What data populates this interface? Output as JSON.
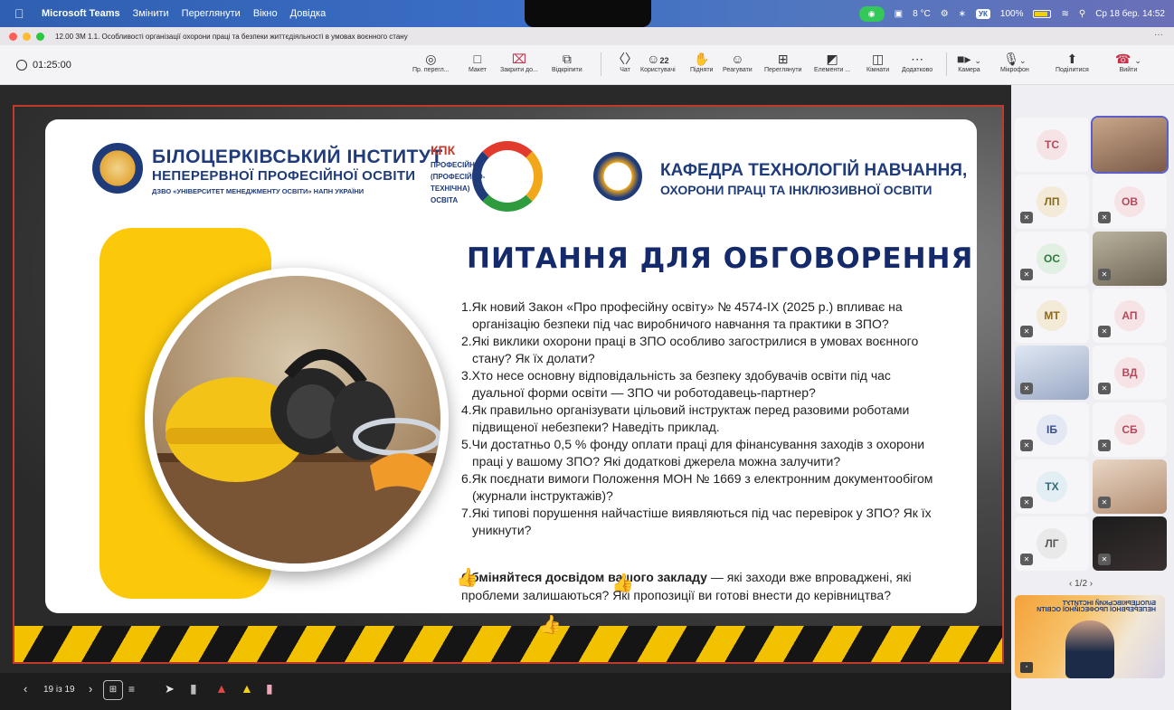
{
  "menubar": {
    "app": "Microsoft Teams",
    "items": [
      "Змінити",
      "Переглянути",
      "Вікно",
      "Довідка"
    ],
    "temperature": "8 °C",
    "lang": "УК",
    "battery": "100%",
    "datetime": "Ср 18 бер.  14:52"
  },
  "window": {
    "title": "12.00 ЗМ 1.1. Особливості організації охорони праці та безпеки життєдіяльності в умовах воєнного стану",
    "more": "···"
  },
  "toolbar": {
    "timer": "01:25:00",
    "buttons": [
      {
        "label": "Пр. перегл...",
        "icon": "eye-icon"
      },
      {
        "label": "Макет",
        "icon": "layout-icon"
      },
      {
        "label": "Закрити до...",
        "icon": "close-share-icon"
      },
      {
        "label": "Відкріпити",
        "icon": "unpin-icon"
      },
      {
        "label": "Чат",
        "icon": "chat-icon"
      },
      {
        "label": "Користувачі",
        "icon": "people-icon",
        "count": "22"
      },
      {
        "label": "Підняти",
        "icon": "hand-icon"
      },
      {
        "label": "Реагувати",
        "icon": "emoji-icon"
      },
      {
        "label": "Переглянути",
        "icon": "view-icon"
      },
      {
        "label": "Елементи ...",
        "icon": "apps-icon"
      },
      {
        "label": "Кімнати",
        "icon": "rooms-icon"
      },
      {
        "label": "Додатково",
        "icon": "more-icon"
      },
      {
        "label": "Камера",
        "icon": "camera-icon"
      },
      {
        "label": "Мікрофон",
        "icon": "microphone-icon"
      },
      {
        "label": "Поділитися",
        "icon": "share-icon"
      },
      {
        "label": "Вийти",
        "icon": "hangup-icon"
      }
    ]
  },
  "slide": {
    "inst_line1": "БІЛОЦЕРКІВСЬКИЙ ІНСТИТУТ",
    "inst_line2": "НЕПЕРЕРВНОЇ ПРОФЕСІЙНОЇ ОСВІТИ",
    "inst_line3": "ДЗВО «УНІВЕРСИТЕТ МЕНЕДЖМЕНТУ ОСВІТИ» НАПН УКРАЇНИ",
    "kpk_title": "КПК",
    "kpk_sub": "ПРОФЕСІЙНА (ПРОФЕСІЙНО-ТЕХНІЧНА) ОСВІТА",
    "dept_line1": "КАФЕДРА ТЕХНОЛОГІЙ НАВЧАННЯ,",
    "dept_line2": "ОХОРОНИ ПРАЦІ ТА ІНКЛЮЗИВНОЇ ОСВІТИ",
    "heading": "ПИТАННЯ ДЛЯ ОБГОВОРЕННЯ",
    "questions": [
      {
        "l1": "1.Як новий Закон «Про професійну освіту» № 4574-IX (2025 р.) впливає на",
        "l2": "   організацію безпеки під час виробничого навчання та практики в ЗПО?"
      },
      {
        "l1": "2.Які виклики охорони праці в ЗПО особливо загострилися в умовах воєнного",
        "l2": "   стану? Як їх долати?"
      },
      {
        "l1": "3.Хто несе основну відповідальність за безпеку здобувачів освіти під час",
        "l2": "   дуальної форми освіти — ЗПО чи роботодавець-партнер?"
      },
      {
        "l1": "4.Як правильно організувати цільовий інструктаж перед разовими роботами",
        "l2": "   підвищеної небезпеки? Наведіть приклад."
      },
      {
        "l1": "5.Чи достатньо 0,5 % фонду оплати праці для фінансування заходів з охорони",
        "l2": "   праці у вашому ЗПО? Які додаткові джерела можна залучити?"
      },
      {
        "l1": "6.Як поєднати вимоги Положення МОН № 1669 з електронним документообігом",
        "l2": "   (журнали інструктажів)?"
      },
      {
        "l1": "7.Які типові порушення найчастіше виявляються під час перевірок у ЗПО? Як їх",
        "l2": "   уникнути?"
      }
    ],
    "exchange_bold": "Обміняйтеся досвідом вашого закладу",
    "exchange_rest": " — які заходи вже впроваджені, які",
    "exchange_line2": "проблеми залишаються? Які пропозиції ви готові внести до керівництва?"
  },
  "bottombar": {
    "prev": "‹",
    "page": "19 із 19",
    "next": "›"
  },
  "participants": {
    "tiles": [
      {
        "initials": "ТС",
        "color": "#f6e3e6",
        "text": "#b5485a"
      },
      {
        "initials": "",
        "video": true
      },
      {
        "initials": "ЛП",
        "color": "#f3ead7",
        "text": "#8a6a1e"
      },
      {
        "initials": "ОВ",
        "color": "#f6e3e6",
        "text": "#b5485a"
      },
      {
        "initials": "ОС",
        "color": "#e2f0e3",
        "text": "#2e7a3a"
      },
      {
        "initials": "",
        "video": true
      },
      {
        "initials": "МТ",
        "color": "#f3ead7",
        "text": "#8a6a1e"
      },
      {
        "initials": "АП",
        "color": "#f6e3e6",
        "text": "#b5485a"
      },
      {
        "initials": "",
        "video": true
      },
      {
        "initials": "ВД",
        "color": "#f6e3e6",
        "text": "#b5485a"
      },
      {
        "initials": "ІБ",
        "color": "#e3e8f4",
        "text": "#3a4f8a"
      },
      {
        "initials": "СБ",
        "color": "#f6e3e6",
        "text": "#b5485a"
      },
      {
        "initials": "ТХ",
        "color": "#e2eef3",
        "text": "#2e6b7a"
      },
      {
        "initials": "",
        "video": true
      },
      {
        "initials": "ЛГ",
        "color": "#e9e9e9",
        "text": "#555"
      },
      {
        "initials": "",
        "video": true
      }
    ],
    "pager": "‹  1/2  ›",
    "stage_video_caption": "БІЛОЦЕРКІВСЬКИЙ ІНСТИТУТ НЕПЕРЕРВНОЇ ПРОФЕСІЙНОЇ ОСВІТИ"
  }
}
